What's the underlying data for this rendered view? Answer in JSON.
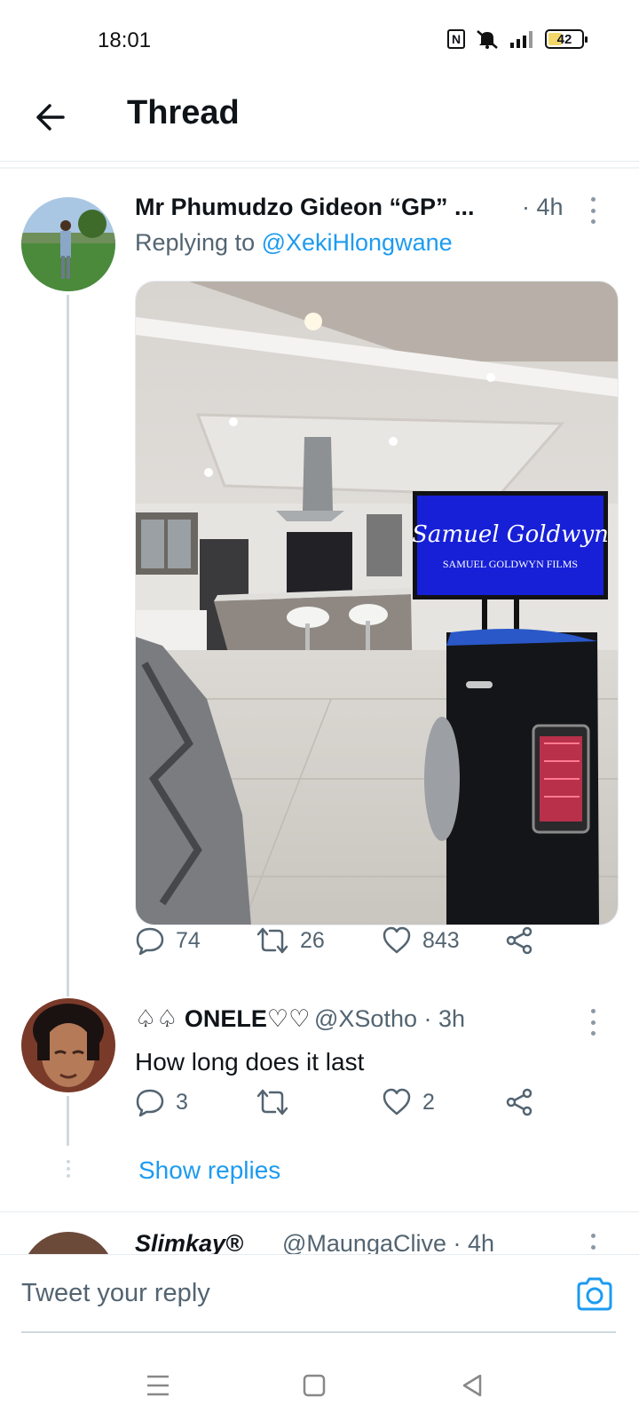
{
  "status_bar": {
    "time": "18:01",
    "battery": "42",
    "battery_fraction": 0.42,
    "icons": [
      "nfc-icon",
      "mute-icon",
      "signal-icon",
      "battery-icon"
    ]
  },
  "header": {
    "title": "Thread",
    "back_icon": "arrow-left-icon"
  },
  "tweets": [
    {
      "name": "Mr Phumudzo Gideon “GP” ...",
      "time": "· 4h",
      "replying_label": "Replying to ",
      "replying_handle": "@XekiHlongwane",
      "media": {
        "tv_signature": "Samuel Goldwyn",
        "tv_caption": "SAMUEL GOLDWYN FILMS"
      },
      "actions": {
        "replies": "74",
        "retweets": "26",
        "likes": "843"
      }
    },
    {
      "name": "♤♤ ONELE♡♡",
      "handle_time": "@XSotho · 3h",
      "text": "How long does it last",
      "actions": {
        "replies": "3",
        "retweets": "",
        "likes": "2"
      },
      "show_replies": "Show replies"
    },
    {
      "name": "Slimkay®",
      "handle_time": "@MaungaClive · 4h"
    }
  ],
  "composer": {
    "placeholder": "Tweet your reply"
  },
  "colors": {
    "accent": "#1d9bf0",
    "text_primary": "#0f1419",
    "text_secondary": "#536471",
    "thread_line": "#cfd9de"
  }
}
